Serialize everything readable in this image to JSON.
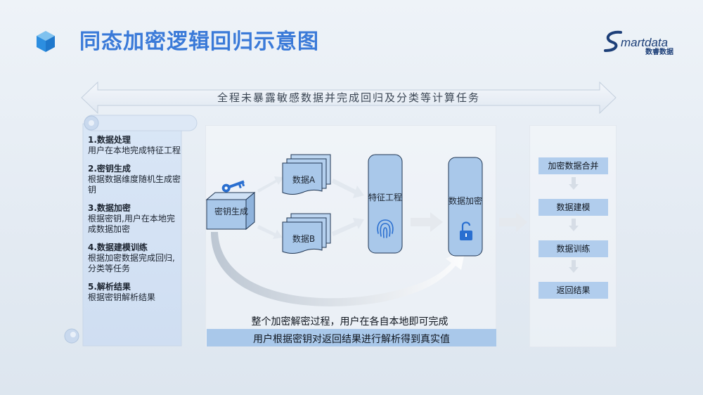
{
  "header": {
    "title": "同态加密逻辑回归示意图",
    "logo_text": "martdata",
    "logo_sub": "数睿数据"
  },
  "banner": {
    "text": "全程未暴露敏感数据并完成回归及分类等计算任务"
  },
  "steps": [
    {
      "title": "1.数据处理",
      "desc": "用户在本地完成特征工程"
    },
    {
      "title": "2.密钥生成",
      "desc": "根据数据维度随机生成密钥"
    },
    {
      "title": "3.数据加密",
      "desc": "根据密钥,用户在本地完成数据加密"
    },
    {
      "title": "4.数据建模训练",
      "desc": "根据加密数据完成回归,分类等任务"
    },
    {
      "title": "5.解析结果",
      "desc": "根据密钥解析结果"
    }
  ],
  "diagram": {
    "key_gen": "密钥生成",
    "data_a": "数据A",
    "data_b": "数据B",
    "feature": "特征工程",
    "encrypt": "数据加密",
    "process_note": "整个加密解密过程，用户在各自本地即可完成",
    "bottom_note": "用户根据密钥对返回结果进行解析得到真实值"
  },
  "right_flow": [
    "加密数据合并",
    "数据建模",
    "数据训练",
    "返回结果"
  ],
  "colors": {
    "title": "#3a7ad8",
    "box_fill": "#a9c8ea",
    "box_stroke": "#1f3552",
    "accent": "#2a6fd0"
  }
}
